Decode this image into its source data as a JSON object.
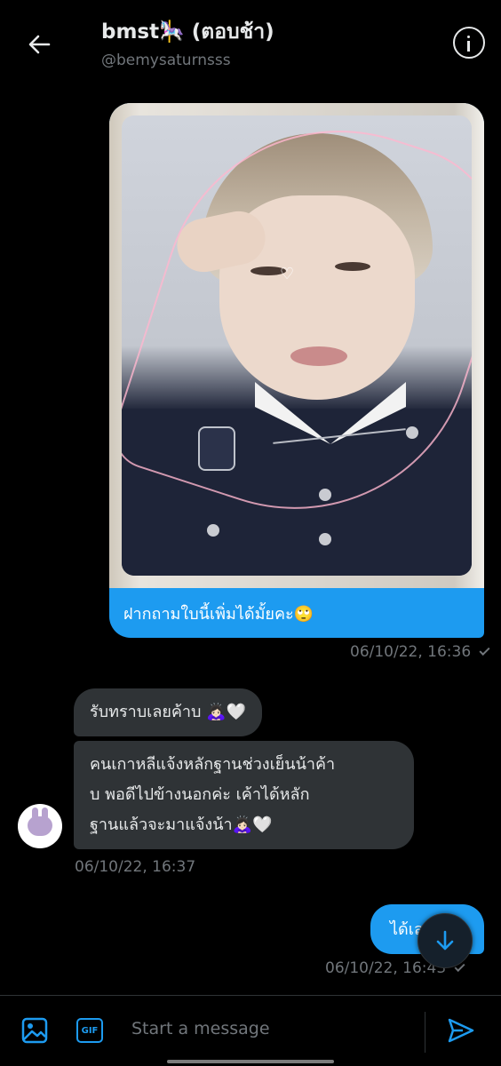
{
  "header": {
    "title": "bmst🎠 (ตอบช้า)",
    "handle": "@bemysaturnsss",
    "back_icon": "arrow-left-icon",
    "info_icon": "info-icon"
  },
  "messages": {
    "media": {
      "caption": "ฝากถามใบนี้เพิ่มได้มั้ยคะ🙄",
      "timestamp": "06/10/22, 16:36",
      "photo_doodle": "♡"
    },
    "incoming": [
      {
        "text": "รับทราบเลยค้าบ 🙇🏻‍♀️🤍"
      },
      {
        "text_lines": [
          "คนเกาหลีแจ้งหลักฐานช่วงเย็นน้าค้า",
          "บ พอดีไปข้างนอกค่ะ เค้าได้หลัก",
          "ฐานแล้วจะมาแจ้งน้า🙇🏻‍♀️🤍"
        ]
      }
    ],
    "incoming_timestamp": "06/10/22, 16:37",
    "outgoing_last": {
      "text": "ได้เลย",
      "timestamp": "06/10/22, 16:43"
    }
  },
  "composer": {
    "placeholder": "Start a message",
    "gif_label": "GIF",
    "media_icon": "image-icon",
    "send_icon": "send-icon"
  },
  "colors": {
    "accent": "#1d9bf0",
    "bubble_incoming": "#2f3336",
    "background": "#000000",
    "muted_text": "#71767b"
  }
}
